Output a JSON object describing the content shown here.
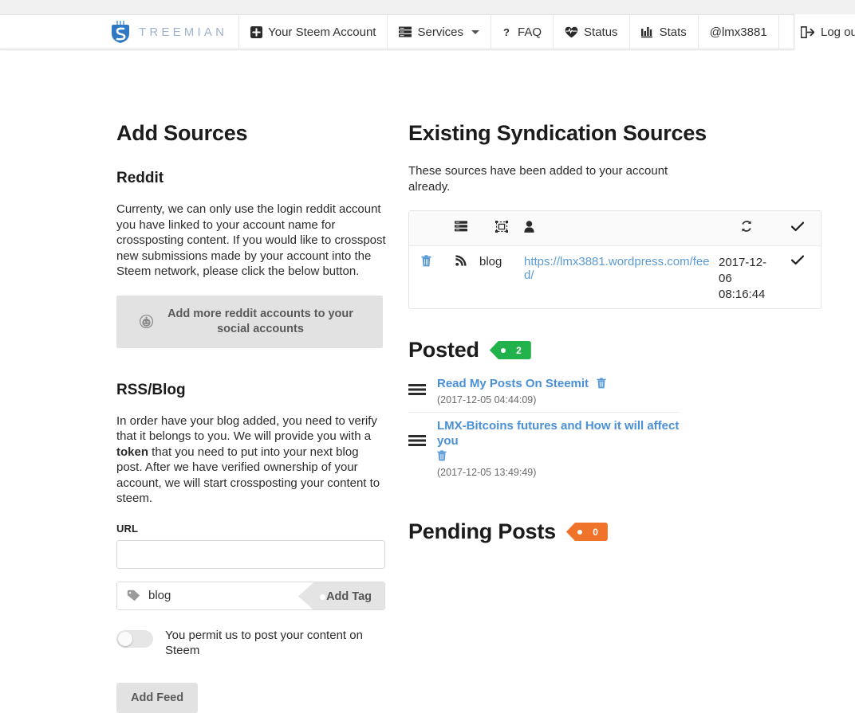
{
  "navbar": {
    "brand": "TREEMIAN",
    "items": [
      {
        "label": "Your Steem Account",
        "icon": "plus-square-icon"
      },
      {
        "label": "Services",
        "icon": "server-icon",
        "caret": true
      },
      {
        "label": "FAQ",
        "icon": "question-icon"
      },
      {
        "label": "Status",
        "icon": "heartbeat-icon"
      },
      {
        "label": "Stats",
        "icon": "bar-chart-icon"
      },
      {
        "label": "@lmx3881",
        "icon": "none"
      }
    ],
    "logout": {
      "label": "Log out",
      "icon": "sign-out-icon"
    }
  },
  "left": {
    "title": "Add Sources",
    "reddit": {
      "heading": "Reddit",
      "body": "Currenty, we can only use the login reddit account you have linked to your account name for crossposting content. If you would like to crosspost new submissions made by your account into the Steem network, please click the below button.",
      "button_label": "Add more reddit accounts to your social accounts",
      "button_icon": "reddit-icon"
    },
    "rss": {
      "heading": "RSS/Blog",
      "body_part1": "In order have your blog added, you need to verify that it belongs to you. We will provide you with a ",
      "body_bold": "token",
      "body_part2": " that you need to put into your next blog post. After we have verified ownership of your account, we will start crossposting your content to steem.",
      "url_label": "URL",
      "url_value": "",
      "url_placeholder": "",
      "tag_value": "blog",
      "add_tag_label": "Add Tag",
      "tag_icon": "tag-icon",
      "permission_label": "You permit us to post your content on Steem",
      "toggle_state": "off",
      "add_feed_label": "Add Feed"
    }
  },
  "right": {
    "title": "Existing Syndication Sources",
    "subtitle": "These sources have been added to your account already.",
    "table": {
      "headers": [
        {
          "icon": "server-list-icon",
          "label": ""
        },
        {
          "icon": "object-group-icon",
          "label": ""
        },
        {
          "icon": "user-icon",
          "label": ""
        },
        {
          "icon": "refresh-icon",
          "label": ""
        },
        {
          "icon": "check-icon",
          "label": ""
        }
      ],
      "rows": [
        {
          "delete_icon": "trash-icon",
          "type_icon": "rss-icon",
          "name": "blog",
          "url": "https://lmx3881.wordpress.com/feed/",
          "date": "2017-12-06 08:16:44",
          "verified_icon": "check-icon"
        }
      ]
    },
    "posted": {
      "heading": "Posted",
      "badge_count": "2",
      "badge_color": "#22b24c",
      "items": [
        {
          "handle_icon": "drag-handle-icon",
          "title": "Read My Posts On Steemit",
          "delete_icon": "trash-icon",
          "date": "(2017-12-05 04:44:09)"
        },
        {
          "handle_icon": "drag-handle-icon",
          "title": "LMX-Bitcoins futures and How it will affect you",
          "delete_icon": "trash-icon",
          "date": "(2017-12-05 13:49:49)"
        }
      ]
    },
    "pending": {
      "heading": "Pending Posts",
      "badge_count": "0",
      "badge_color": "#f0732b",
      "items": []
    }
  },
  "colors": {
    "link_blue": "#5b9bd5",
    "post_link_blue": "#4a90d9",
    "brand_grey_blue": "#9fb2c9",
    "green_badge": "#22b24c",
    "orange_badge": "#f0732b"
  }
}
